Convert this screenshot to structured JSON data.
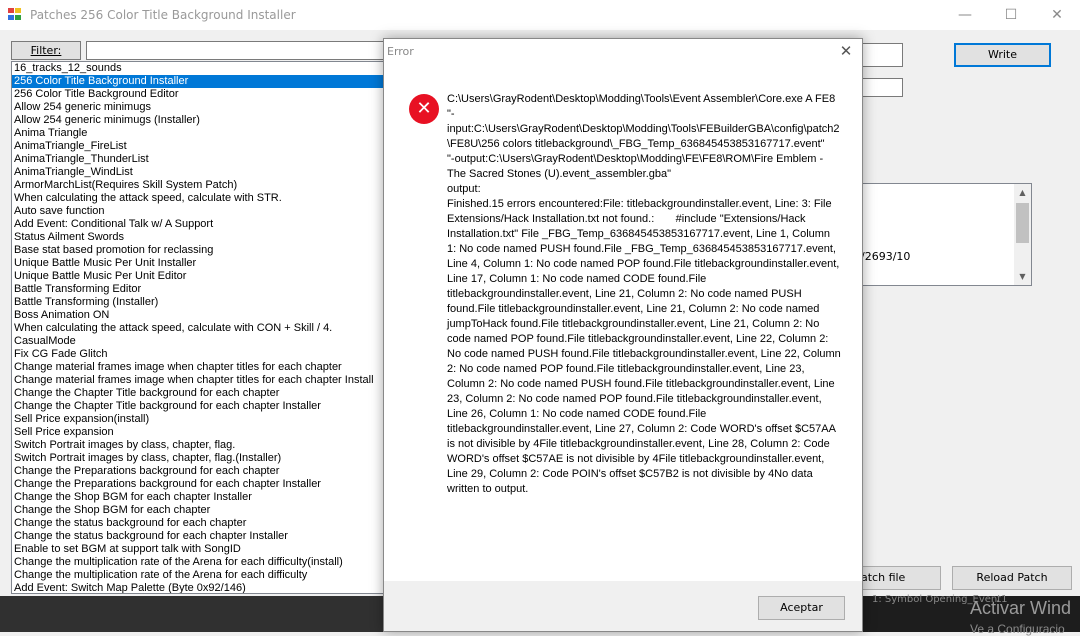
{
  "window": {
    "title": "Patches 256 Color Title Background Installer",
    "minimize_glyph": "—",
    "maximize_glyph": "☐",
    "close_glyph": "✕"
  },
  "filter": {
    "label": "Filter:",
    "value": ""
  },
  "patch_list": {
    "selected_index": 1,
    "items": [
      "16_tracks_12_sounds",
      "256 Color Title Background Installer",
      "256 Color Title Background Editor",
      "Allow 254 generic minimugs",
      "Allow 254 generic minimugs (Installer)",
      "Anima Triangle",
      "AnimaTriangle_FireList",
      "AnimaTriangle_ThunderList",
      "AnimaTriangle_WindList",
      "ArmorMarchList(Requires Skill System Patch)",
      "When calculating the attack speed, calculate with STR.",
      "Auto save function",
      "Add Event: Conditional Talk w/ A Support",
      "Status Ailment Swords",
      "Base stat based promotion for reclassing",
      "Unique Battle Music Per Unit Installer",
      "Unique Battle Music Per Unit Editor",
      "Battle Transforming Editor",
      "Battle Transforming (Installer)",
      "Boss Animation ON",
      "When calculating the attack speed, calculate with CON + Skill / 4.",
      "CasualMode",
      "Fix CG Fade Glitch",
      "Change material frames image when chapter titles for each chapter",
      "Change material frames image when chapter titles for each chapter Install",
      "Change the Chapter Title  background for each chapter",
      "Change the Chapter Title  background for each chapter Installer",
      "Sell Price expansion(install)",
      "Sell Price expansion",
      "Switch Portrait images by class, chapter, flag.",
      "Switch Portrait images by class, chapter, flag.(Installer)",
      "Change the Preparations background for each chapter",
      "Change the Preparations background for each chapter Installer",
      "Change the Shop BGM for each chapter Installer",
      "Change the Shop BGM for each chapter",
      "Change the status background for each chapter",
      "Change the status background for each chapter Installer",
      "Enable to set BGM at support talk with SongID",
      "Change the multiplication rate of the Arena for each difficulty(install)",
      "Change the multiplication rate of the Arena for each difficulty",
      "Add Event: Switch Map Palette (Byte 0x92/146)"
    ]
  },
  "right_panel": {
    "write_label": "Write",
    "info_text": "/2693/10",
    "patch_file_label": "atch file",
    "reload_label": "Reload Patch"
  },
  "taskbar": {
    "behind_text": "1: Symbol Opening_Event1",
    "watermark_line1": "Activar Wind",
    "watermark_line2": "Ve a Configuracio"
  },
  "dialog": {
    "title": "Error",
    "close_glyph": "✕",
    "icon_glyph": "✕",
    "message": "C:\\Users\\GrayRodent\\Desktop\\Modding\\Tools\\Event Assembler\\Core.exe A FE8\n\"-input:C:\\Users\\GrayRodent\\Desktop\\Modding\\Tools\\FEBuilderGBA\\config\\patch2\\FE8U\\256 colors titlebackground\\_FBG_Temp_636845453853167717.event\"\n\"-output:C:\\Users\\GrayRodent\\Desktop\\Modding\\FE\\FE8\\ROM\\Fire Emblem - The Sacred Stones (U).event_assembler.gba\"\noutput:\nFinished.15 errors encountered:File: titlebackgroundinstaller.event, Line: 3: File Extensions/Hack Installation.txt not found.:       #include \"Extensions/Hack Installation.txt\" File _FBG_Temp_636845453853167717.event, Line 1, Column 1: No code named PUSH found.File _FBG_Temp_636845453853167717.event, Line 4, Column 1: No code named POP found.File titlebackgroundinstaller.event, Line 17, Column 1: No code named CODE found.File titlebackgroundinstaller.event, Line 21, Column 2: No code named PUSH found.File titlebackgroundinstaller.event, Line 21, Column 2: No code named jumpToHack found.File titlebackgroundinstaller.event, Line 21, Column 2: No code named POP found.File titlebackgroundinstaller.event, Line 22, Column 2: No code named PUSH found.File titlebackgroundinstaller.event, Line 22, Column 2: No code named POP found.File titlebackgroundinstaller.event, Line 23, Column 2: No code named PUSH found.File titlebackgroundinstaller.event, Line 23, Column 2: No code named POP found.File titlebackgroundinstaller.event, Line 26, Column 1: No code named CODE found.File titlebackgroundinstaller.event, Line 27, Column 2: Code WORD's offset $C57AA is not divisible by 4File titlebackgroundinstaller.event, Line 28, Column 2: Code WORD's offset $C57AE is not divisible by 4File titlebackgroundinstaller.event, Line 29, Column 2: Code POIN's offset $C57B2 is not divisible by 4No data written to output.",
    "ok_label": "Aceptar"
  },
  "colors": {
    "selection": "#0078d7",
    "error_red": "#e81123",
    "focus_border": "#0078d7"
  }
}
